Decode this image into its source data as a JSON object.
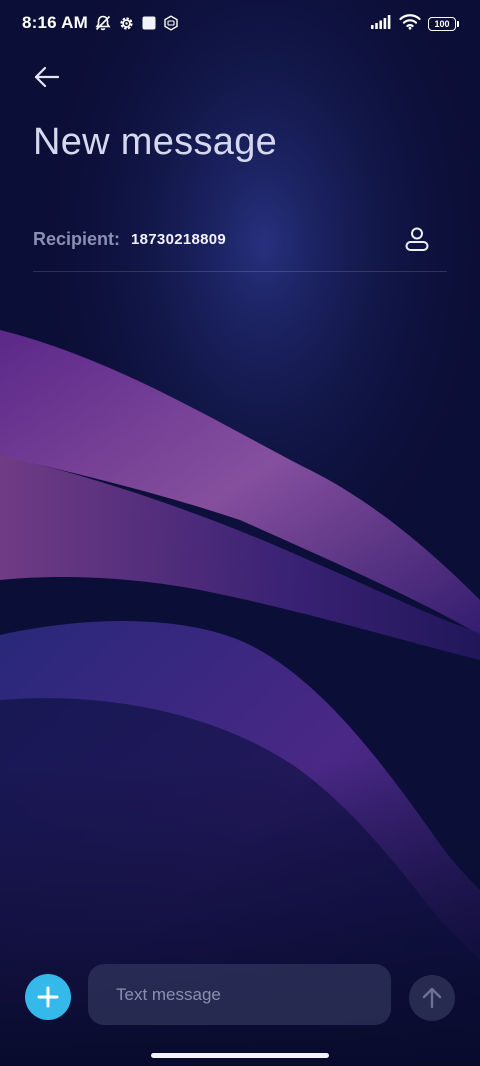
{
  "status_bar": {
    "time": "8:16 AM",
    "icons": [
      "bell-off-icon",
      "gear-icon",
      "square-notification-icon",
      "mi-badge-icon",
      "signal-icon",
      "wifi-icon"
    ],
    "battery_level": "100"
  },
  "header": {
    "back_icon": "arrow-left-icon",
    "title": "New message"
  },
  "recipient": {
    "label": "Recipient:",
    "number": "18730218809",
    "contact_icon": "person-icon"
  },
  "compose": {
    "add_icon": "plus-icon",
    "placeholder": "Text message",
    "send_icon": "arrow-up-icon"
  },
  "colors": {
    "accent": "#35b9ea",
    "background": "#0b0e36",
    "title": "#d5d8ee",
    "label": "#8a8fb4"
  }
}
